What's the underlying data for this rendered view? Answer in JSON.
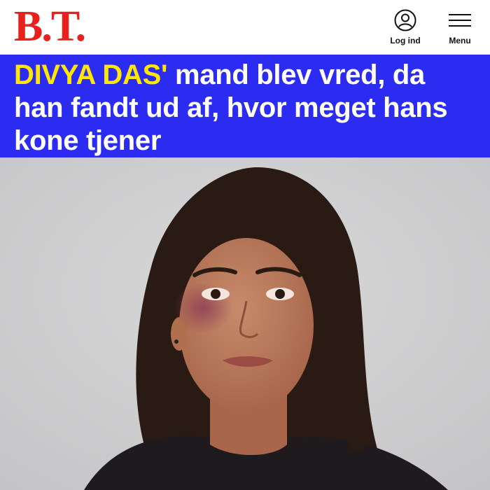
{
  "header": {
    "logo_text": "B.T.",
    "brand_color": "#e8211e",
    "login": {
      "icon": "user-circle-icon",
      "label": "Log ind"
    },
    "menu": {
      "icon": "hamburger-menu-icon",
      "label": "Menu"
    }
  },
  "article": {
    "headline_kicker": "DIVYA DAS'",
    "headline_rest": " mand blev vred, da han fandt ud af, hvor meget hans kone tjener",
    "headline_bg_color": "#2b2bf2",
    "kicker_color": "#ffe800",
    "hero_image": {
      "subject": "portrait-photo"
    }
  }
}
